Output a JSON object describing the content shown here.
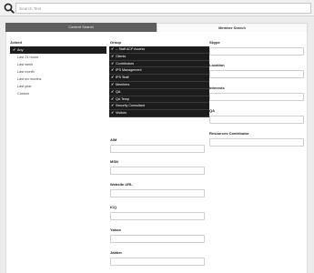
{
  "search": {
    "placeholder": "Search Text"
  },
  "tabs": [
    {
      "label": "Content Search"
    },
    {
      "label": "Member Search"
    }
  ],
  "joined": {
    "label": "Joined",
    "options": [
      "Any",
      "Last 24 hours",
      "Last week",
      "Last month",
      "Last six months",
      "Last year",
      "Custom"
    ],
    "selected": "Any"
  },
  "group": {
    "label": "Group",
    "options": [
      "-- Staff ACP Access",
      "Clients",
      "Contributors",
      "IPS Management",
      "IPS Staff",
      "Members",
      "QA",
      "QA Temp",
      "Security Consultant",
      "Visitors"
    ]
  },
  "fields_middle": [
    {
      "label": "AIM"
    },
    {
      "label": "MSN"
    },
    {
      "label": "Website URL"
    },
    {
      "label": "ICQ"
    },
    {
      "label": "Yahoo"
    },
    {
      "label": "Jabber"
    }
  ],
  "fields_right": [
    {
      "label": "Skype"
    },
    {
      "label": "Location"
    },
    {
      "label": "Interests"
    },
    {
      "label": "QA"
    },
    {
      "label": "Resources Contributor"
    }
  ],
  "colors": {
    "selected_bg": "#1c1c1c",
    "tab_inactive_bg": "#5e5e5e",
    "page_bg": "#ececec"
  }
}
